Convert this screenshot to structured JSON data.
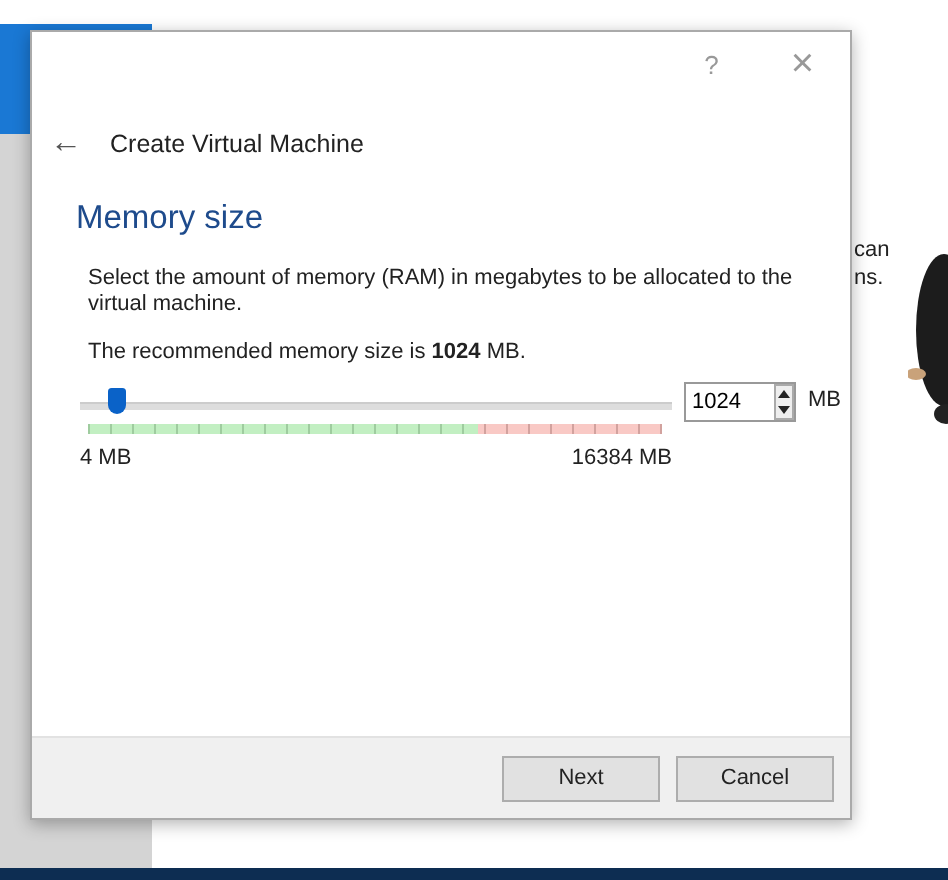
{
  "background": {
    "text_lines": [
      "can",
      "ns."
    ]
  },
  "dialog": {
    "help": "?",
    "close": "×",
    "back": "←",
    "title": "Create Virtual Machine",
    "heading": "Memory size",
    "description": "Select the amount of memory (RAM) in megabytes to be allocated to the virtual machine.",
    "recommendation": "The recommended memory size is **1024** MB.",
    "slider": {
      "level": 0.062,
      "min_label": "4 MB",
      "max_label": "16384 MB"
    },
    "spinbox": {
      "value": "1024",
      "unit": "MB"
    },
    "buttons": [
      {
        "label": "Next"
      },
      {
        "label": "Cancel"
      }
    ]
  }
}
